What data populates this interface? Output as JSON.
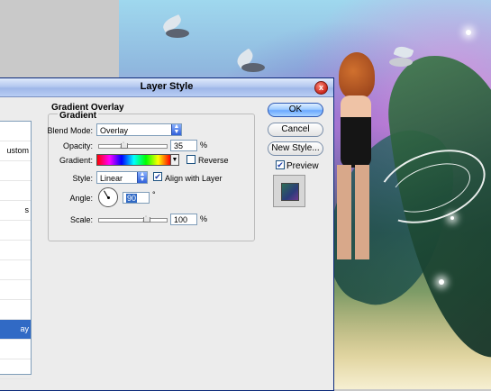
{
  "dialog": {
    "title": "Layer Style",
    "close_glyph": "x"
  },
  "left_panel": {
    "items": [
      "",
      "ustom",
      "",
      "",
      "s",
      "",
      "",
      "",
      "",
      "",
      "ay",
      "",
      ""
    ],
    "selected_index": 10
  },
  "gradient_overlay": {
    "section_title": "Gradient Overlay",
    "group_title": "Gradient",
    "blend_mode": {
      "label": "Blend Mode:",
      "value": "Overlay"
    },
    "opacity": {
      "label": "Opacity:",
      "value": "35",
      "unit": "%",
      "level": 0.35
    },
    "gradient": {
      "label": "Gradient:",
      "colors": [
        "#ff0000",
        "#ff00ff",
        "#0000ff",
        "#00ffff",
        "#00ff00",
        "#ffff00",
        "#ff0000"
      ]
    },
    "reverse": {
      "label": "Reverse",
      "checked": false
    },
    "style": {
      "label": "Style:",
      "value": "Linear"
    },
    "align_with_layer": {
      "label": "Align with Layer",
      "checked": true
    },
    "angle": {
      "label": "Angle:",
      "value": "90",
      "unit": "°",
      "degrees": 90
    },
    "scale": {
      "label": "Scale:",
      "value": "100",
      "unit": "%",
      "level": 0.67
    }
  },
  "buttons": {
    "ok": "OK",
    "cancel": "Cancel",
    "new_style": "New Style...",
    "preview_label": "Preview",
    "preview_checked": true
  },
  "colors": {
    "title_bar": "#b4c8ef",
    "selection": "#316ac5",
    "dialog_bg": "#ececec"
  }
}
